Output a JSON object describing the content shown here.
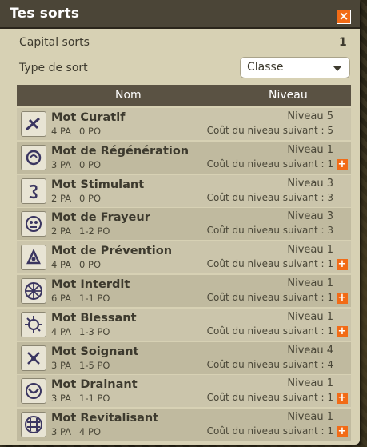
{
  "window": {
    "title": "Tes sorts"
  },
  "capital": {
    "label": "Capital sorts",
    "value": "1"
  },
  "type_filter": {
    "label": "Type de sort",
    "selected": "Classe"
  },
  "table": {
    "col_name": "Nom",
    "col_level": "Niveau"
  },
  "spells": [
    {
      "name": "Mot Curatif",
      "pa": "4 PA",
      "po": "0 PO",
      "level": "Niveau 5",
      "cost": "Coût du niveau suivant : 5",
      "upgradable": false,
      "icon": "curative-icon"
    },
    {
      "name": "Mot de Régénération",
      "pa": "3 PA",
      "po": "0 PO",
      "level": "Niveau 1",
      "cost": "Coût du niveau suivant : 1",
      "upgradable": true,
      "icon": "regeneration-icon"
    },
    {
      "name": "Mot Stimulant",
      "pa": "2 PA",
      "po": "0 PO",
      "level": "Niveau 3",
      "cost": "Coût du niveau suivant : 3",
      "upgradable": false,
      "icon": "stimulant-icon"
    },
    {
      "name": "Mot de Frayeur",
      "pa": "2 PA",
      "po": "1-2 PO",
      "level": "Niveau 3",
      "cost": "Coût du niveau suivant : 3",
      "upgradable": false,
      "icon": "fear-icon"
    },
    {
      "name": "Mot de Prévention",
      "pa": "4 PA",
      "po": "0 PO",
      "level": "Niveau 1",
      "cost": "Coût du niveau suivant : 1",
      "upgradable": true,
      "icon": "prevention-icon"
    },
    {
      "name": "Mot Interdit",
      "pa": "6 PA",
      "po": "1-1 PO",
      "level": "Niveau 1",
      "cost": "Coût du niveau suivant : 1",
      "upgradable": true,
      "icon": "forbidden-icon"
    },
    {
      "name": "Mot Blessant",
      "pa": "4 PA",
      "po": "1-3 PO",
      "level": "Niveau 1",
      "cost": "Coût du niveau suivant : 1",
      "upgradable": true,
      "icon": "wounding-icon"
    },
    {
      "name": "Mot Soignant",
      "pa": "3 PA",
      "po": "1-5 PO",
      "level": "Niveau 4",
      "cost": "Coût du niveau suivant : 4",
      "upgradable": false,
      "icon": "healing-icon"
    },
    {
      "name": "Mot Drainant",
      "pa": "3 PA",
      "po": "1-1 PO",
      "level": "Niveau 1",
      "cost": "Coût du niveau suivant : 1",
      "upgradable": true,
      "icon": "draining-icon"
    },
    {
      "name": "Mot Revitalisant",
      "pa": "3 PA",
      "po": "4 PO",
      "level": "Niveau 1",
      "cost": "Coût du niveau suivant : 1",
      "upgradable": true,
      "icon": "revitalizing-icon"
    }
  ],
  "colors": {
    "accent": "#f26b16",
    "header_bg": "#5a5243",
    "title_bg": "#4b4537",
    "panel_bg": "#d7d1b4"
  }
}
